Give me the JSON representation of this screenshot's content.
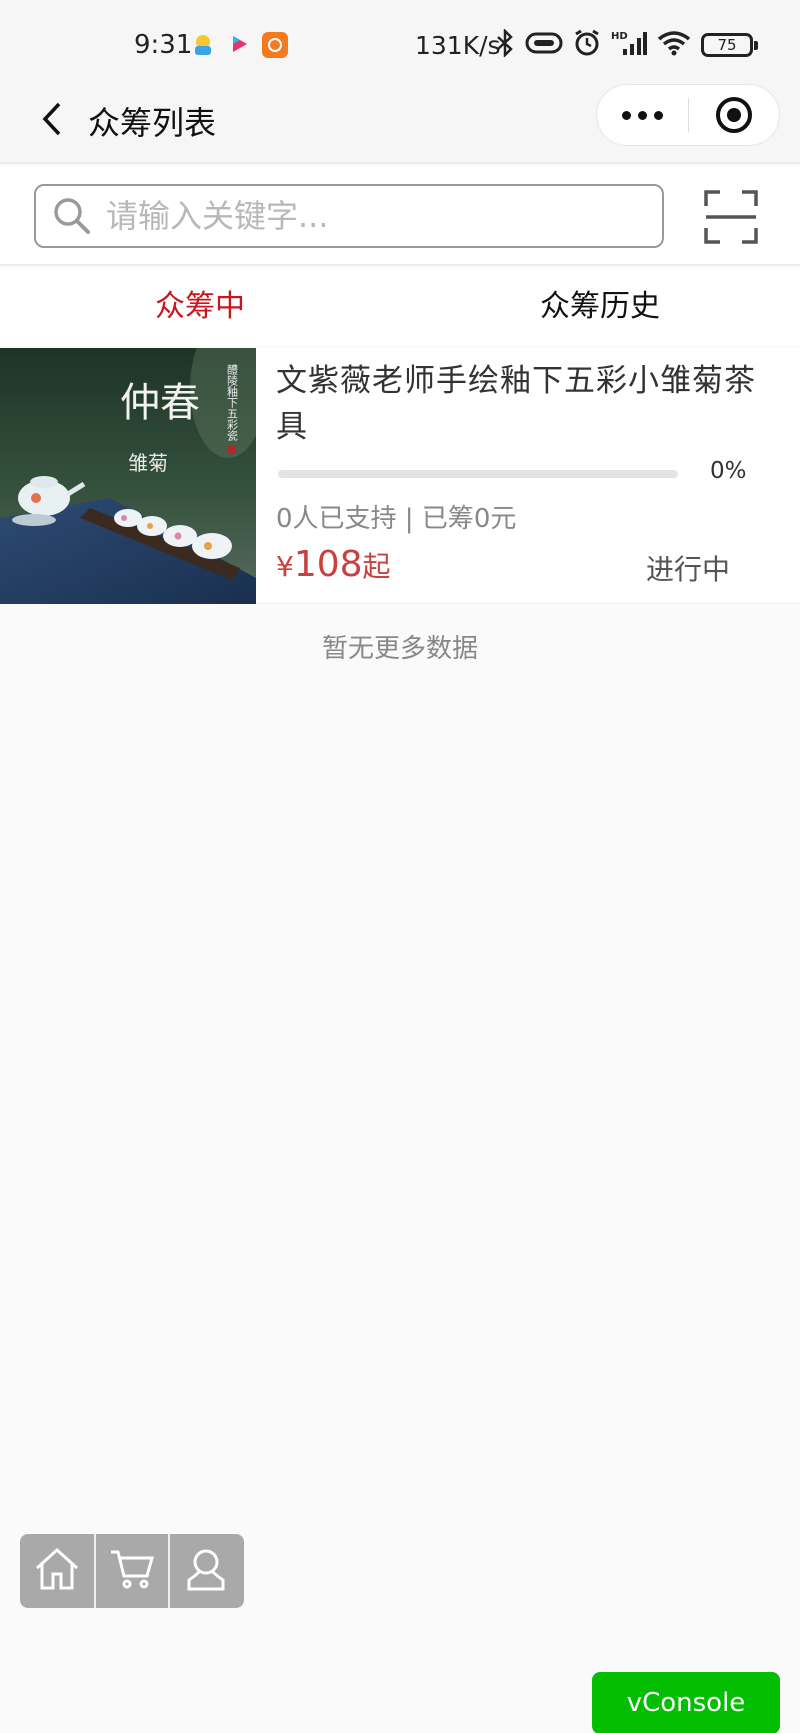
{
  "status_bar": {
    "time": "9:31",
    "network_speed": "131K/s",
    "battery": "75",
    "icons": [
      "bluetooth-icon",
      "nfc-icon",
      "alarm-icon",
      "hd-signal-icon",
      "wifi-icon",
      "battery-icon"
    ],
    "app_icons": [
      "kids-app-icon",
      "youku-app-icon",
      "orange-app-icon"
    ]
  },
  "nav": {
    "title": "众筹列表",
    "back_icon": "chevron-left-icon",
    "more_icon": "more-dots-icon",
    "close_icon": "target-close-icon"
  },
  "search": {
    "placeholder": "请输入关键字...",
    "value": "",
    "icon": "search-icon",
    "scan_icon": "scan-icon"
  },
  "tabs": [
    {
      "label": "众筹中",
      "active": true
    },
    {
      "label": "众筹历史",
      "active": false
    }
  ],
  "items": [
    {
      "title": "文紫薇老师手绘釉下五彩小雏菊茶具",
      "image_text": "仲春",
      "image_sub": "雏菊",
      "image_vertical": "醴陵釉下五彩瓷",
      "progress_pct": "0%",
      "progress_value": 0,
      "supporters": "0人已支持 | 已筹0元",
      "price_currency": "¥",
      "price_value": "108",
      "price_suffix": "起",
      "status": "进行中"
    }
  ],
  "no_more": "暂无更多数据",
  "float_nav": [
    "home-icon",
    "cart-icon",
    "user-icon"
  ],
  "vconsole_label": "vConsole",
  "colors": {
    "accent": "#c8161d",
    "price": "#c94040",
    "vconsole": "#04be02",
    "float_nav_bg": "#a9a9a9"
  }
}
